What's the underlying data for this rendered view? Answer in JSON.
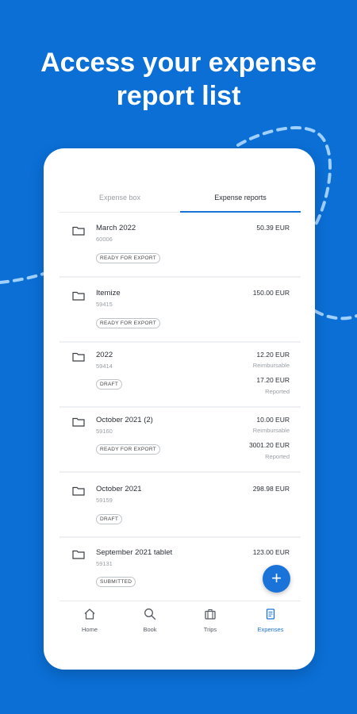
{
  "headline": {
    "line1": "Access your expense",
    "line2": "report list"
  },
  "tabs": [
    {
      "label": "Expense box",
      "active": false
    },
    {
      "label": "Expense reports",
      "active": true
    }
  ],
  "reports": [
    {
      "title": "March 2022",
      "number": "60006",
      "status": "READY FOR EXPORT",
      "amount": "50.39 EUR"
    },
    {
      "title": "Itemize",
      "number": "59415",
      "status": "READY FOR EXPORT",
      "amount": "150.00 EUR"
    },
    {
      "title": "2022",
      "number": "59414",
      "status": "DRAFT",
      "amount": "12.20 EUR",
      "amount_note": "Reimbursable",
      "amount2": "17.20 EUR",
      "amount2_note": "Reported"
    },
    {
      "title": "October 2021 (2)",
      "number": "59160",
      "status": "READY FOR EXPORT",
      "amount": "10.00 EUR",
      "amount_note": "Reimbursable",
      "amount2": "3001.20 EUR",
      "amount2_note": "Reported"
    },
    {
      "title": "October 2021",
      "number": "59159",
      "status": "DRAFT",
      "amount": "298.98 EUR"
    },
    {
      "title": "September 2021 tablet",
      "number": "59131",
      "status": "SUBMITTED",
      "amount": "123.00 EUR"
    }
  ],
  "fab": {
    "symbol": "+",
    "icon": "plus-icon"
  },
  "bottom_nav": [
    {
      "label": "Home",
      "icon": "home-icon",
      "active": false
    },
    {
      "label": "Book",
      "icon": "search-icon",
      "active": false
    },
    {
      "label": "Trips",
      "icon": "suitcase-icon",
      "active": false
    },
    {
      "label": "Expenses",
      "icon": "receipt-icon",
      "active": true
    }
  ],
  "colors": {
    "background": "#0b6fd6",
    "accent": "#1a73d9",
    "card": "#ffffff",
    "screen_bg": "#eef0f3"
  }
}
